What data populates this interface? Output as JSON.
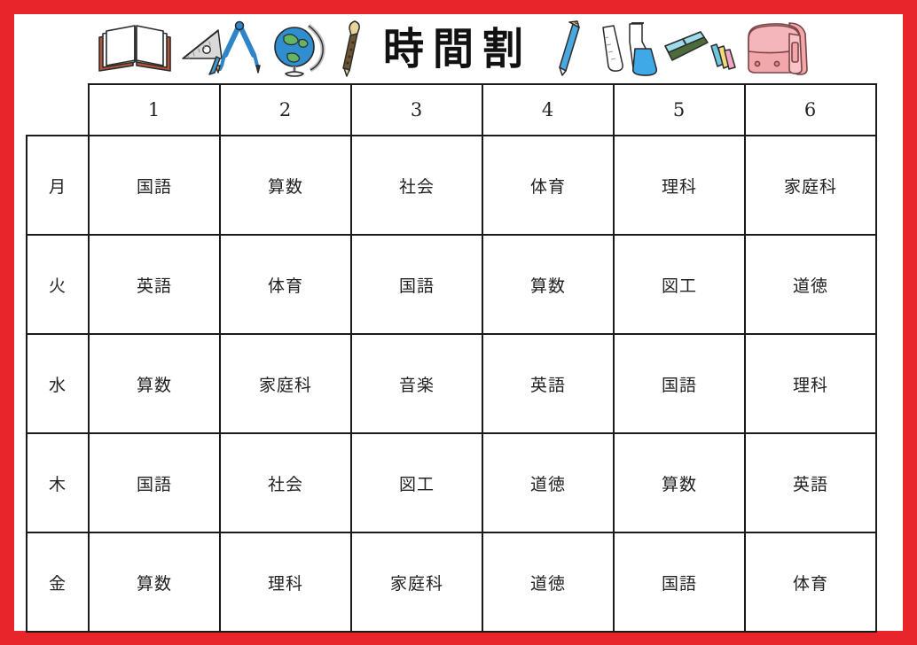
{
  "page": {
    "title": "時間割",
    "border_color": "#e8252b",
    "background_color": "#ffffff",
    "grid_line_color": "#1a1a1a"
  },
  "header": {
    "title": "時間割",
    "decorations": [
      {
        "name": "open-book-icon",
        "label": "開いた本",
        "colors": [
          "#ffffff",
          "#b4543a"
        ]
      },
      {
        "name": "ruler-compass-icon",
        "label": "三角定規とコンパス",
        "colors": [
          "#d8d8d8",
          "#2e84c8"
        ]
      },
      {
        "name": "globe-icon",
        "label": "地球儀",
        "colors": [
          "#2e8ed0",
          "#63b463",
          "#dcdcdc"
        ]
      },
      {
        "name": "recorder-icon",
        "label": "リコーダー",
        "colors": [
          "#6b5532",
          "#e6d49a"
        ]
      },
      {
        "name": "pencil-icon",
        "label": "鉛筆",
        "colors": [
          "#4aa8e0",
          "#e8c88c"
        ]
      },
      {
        "name": "flask-icon",
        "label": "フラスコ",
        "colors": [
          "#3fa9e8",
          "#ffffff"
        ]
      },
      {
        "name": "pencil-case-icon",
        "label": "筆箱",
        "colors": [
          "#4d6b3a",
          "#9fdceb"
        ]
      },
      {
        "name": "backpack-icon",
        "label": "ランドセル",
        "colors": [
          "#f2a7ab",
          "#e8888f"
        ]
      }
    ]
  },
  "table": {
    "corner_label": "",
    "period_headers": [
      "1",
      "2",
      "3",
      "4",
      "5",
      "6"
    ],
    "rows": [
      {
        "day": "月",
        "subjects": [
          "国語",
          "算数",
          "社会",
          "体育",
          "理科",
          "家庭科"
        ]
      },
      {
        "day": "火",
        "subjects": [
          "英語",
          "体育",
          "国語",
          "算数",
          "図工",
          "道徳"
        ]
      },
      {
        "day": "水",
        "subjects": [
          "算数",
          "家庭科",
          "音楽",
          "英語",
          "国語",
          "理科"
        ]
      },
      {
        "day": "木",
        "subjects": [
          "国語",
          "社会",
          "図工",
          "道徳",
          "算数",
          "英語"
        ]
      },
      {
        "day": "金",
        "subjects": [
          "算数",
          "理科",
          "家庭科",
          "道徳",
          "国語",
          "体育"
        ]
      }
    ]
  }
}
